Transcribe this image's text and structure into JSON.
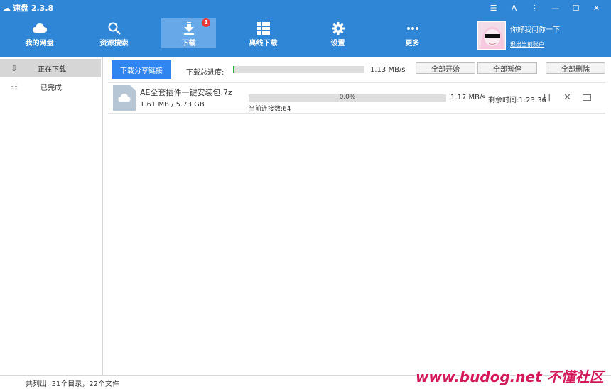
{
  "app": {
    "title": "速盘 2.3.8"
  },
  "window_controls": [
    "☰",
    "ᐱ",
    "⋮",
    "—",
    "☐",
    "✕"
  ],
  "nav": [
    {
      "label": "我的网盘",
      "icon": "cloud-icon"
    },
    {
      "label": "资源搜索",
      "icon": "search-icon"
    },
    {
      "label": "下载",
      "icon": "download-icon",
      "badge": "1",
      "active": true
    },
    {
      "label": "离线下载",
      "icon": "grid-list-icon"
    },
    {
      "label": "设置",
      "icon": "gear-icon"
    },
    {
      "label": "更多",
      "icon": "more-icon"
    }
  ],
  "user": {
    "name": "你好我问你一下",
    "logout": "退出当前账户"
  },
  "sidebar": {
    "items": [
      {
        "label": "正在下载",
        "icon": "down-arrow-icon",
        "active": true
      },
      {
        "label": "已完成",
        "icon": "list-icon"
      }
    ]
  },
  "toolbar": {
    "share_label": "下载分享链接",
    "total_label": "下载总进度:",
    "total_progress": 0.01,
    "total_speed": "1.13 MB/s",
    "start_all": "全部开始",
    "pause_all": "全部暂停",
    "delete_all": "全部删除"
  },
  "downloads": [
    {
      "name": "AE全套插件一键安装包.7z",
      "size": "1.61 MB / 5.73 GB",
      "progress_text": "0.0%",
      "progress": 0.0,
      "connections": "当前连接数:64",
      "speed": "1.17 MB/s",
      "remaining": "剩余时间:1:23:36",
      "pause_symbol": "| |"
    }
  ],
  "status": {
    "text": "共列出: 31个目录，22个文件"
  },
  "watermark": "www.budog.net 不懂社区",
  "colors": {
    "header": "#2f86d6",
    "accent": "#2f86f0",
    "progress": "#1fb53a",
    "badge": "#e83a3a"
  }
}
